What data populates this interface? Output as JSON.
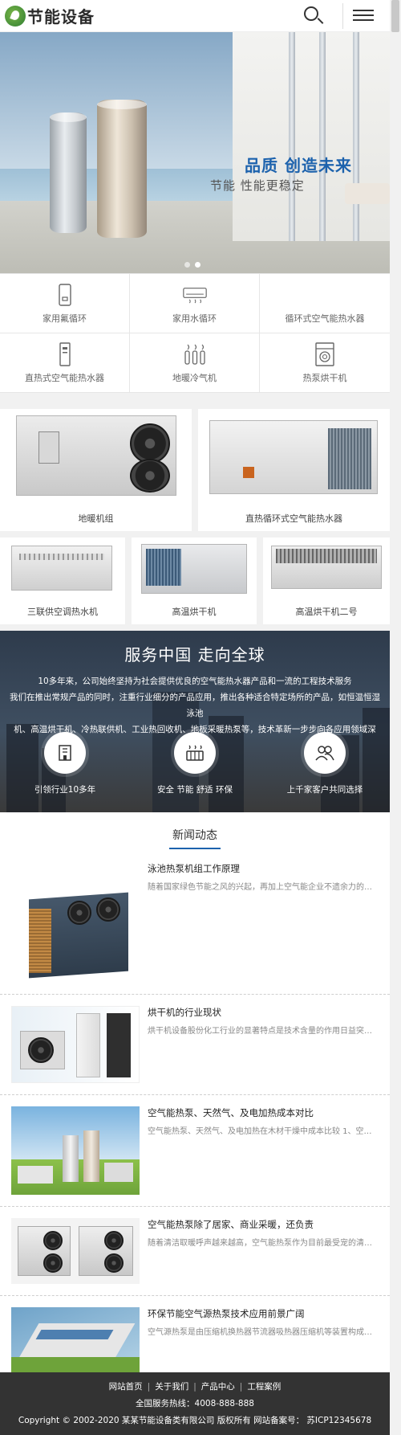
{
  "header": {
    "logo_text": "节能设备"
  },
  "banner": {
    "slogan": "品质 创造未来",
    "subslogan": "节能 性能更稳定"
  },
  "categories": [
    {
      "label": "家用氟循环",
      "icon": "tank-icon"
    },
    {
      "label": "家用水循环",
      "icon": "ac-unit-icon"
    },
    {
      "label": "循环式空气能热水器",
      "icon": ""
    },
    {
      "label": "直热式空气能热水器",
      "icon": "heater-icon"
    },
    {
      "label": "地暖冷气机",
      "icon": "radiator-icon"
    },
    {
      "label": "热泵烘干机",
      "icon": "dryer-icon"
    }
  ],
  "products": {
    "row1": [
      {
        "name": "地暖机组"
      },
      {
        "name": "直热循环式空气能热水器"
      }
    ],
    "row2": [
      {
        "name": "三联供空调热水机"
      },
      {
        "name": "高温烘干机"
      },
      {
        "name": "高温烘干机二号"
      }
    ]
  },
  "service": {
    "title": "服务中国 走向全球",
    "lines": [
      "10多年来，公司始终坚持为社会提供优良的空气能热水器产品和一流的工程技术服务",
      "我们在推出常规产品的同时，注重行业细分的产品应用，推出各种适合特定场所的产品，如恒温恒湿泳池",
      "机、高温烘干机、冷热联供机、工业热回收机、地板采暖热泵等，技术革新一步步向各应用领域深化。"
    ],
    "items": [
      {
        "label": "引领行业10多年",
        "icon": "building-icon"
      },
      {
        "label": "安全 节能 舒适 环保",
        "icon": "heater-icon"
      },
      {
        "label": "上千家客户共同选择",
        "icon": "users-icon"
      }
    ]
  },
  "news": {
    "title": "新闻动态",
    "items": [
      {
        "title": "泳池热泵机组工作原理",
        "summary": "随着国家绿色节能之风的兴起，再加上空气能企业不遗余力的推..."
      },
      {
        "title": "烘干机的行业现状",
        "summary": "烘干机设备股份化工行业的显著特点是技术含量的作用日益突出..."
      },
      {
        "title": "空气能热泵、天然气、及电加热成本对比",
        "summary": "空气能热泵、天然气、及电加热在木材干燥中成本比较 1、空气..."
      },
      {
        "title": "空气能热泵除了居家、商业采暖，还负责",
        "summary": "随着清洁取暖呼声越来越高，空气能热泵作为目前最受宠的清洁..."
      },
      {
        "title": "环保节能空气源热泵技术应用前景广阔",
        "summary": "空气源热泵是由压缩机换热器节流器吸热器压缩机等装置构成了..."
      }
    ]
  },
  "footer": {
    "nav": [
      "网站首页",
      "关于我们",
      "产品中心",
      "工程案例"
    ],
    "separator": "|",
    "hotline": "全国服务热线：4008-888-888",
    "copyright": "Copyright © 2002-2020 某某节能设备类有限公司 版权所有 网站备案号： 苏ICP12345678"
  },
  "colors": {
    "accent": "#1c62ad",
    "footer_bg": "#333333",
    "section_bg": "#f1f1f1"
  }
}
